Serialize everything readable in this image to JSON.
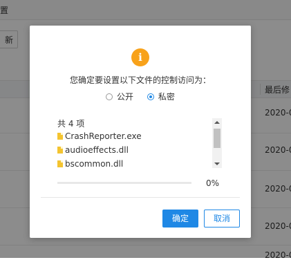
{
  "background": {
    "tab_label": "置",
    "refresh_label": "新",
    "column_header": "最后修",
    "dates": [
      "2020-0",
      "2020-0",
      "2020-0",
      "2020-0",
      "2020-0"
    ]
  },
  "dialog": {
    "icon_glyph": "i",
    "question": "您确定要设置以下文件的控制访问为：",
    "options": [
      {
        "label": "公开",
        "selected": false
      },
      {
        "label": "私密",
        "selected": true
      }
    ],
    "file_count": "共 4 项",
    "files": [
      "CrashReporter.exe",
      "audioeffects.dll",
      "bscommon.dll"
    ],
    "progress": {
      "value": 0,
      "label": "0%"
    },
    "confirm_label": "确定",
    "cancel_label": "取消"
  },
  "colors": {
    "accent": "#1f88e5",
    "warning": "#f8a21a",
    "file_icon": "#f4c430"
  }
}
